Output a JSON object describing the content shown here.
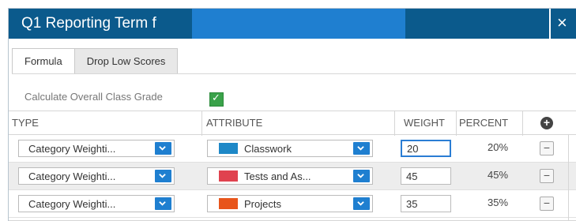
{
  "dialog": {
    "title": "Q1 Reporting Term f",
    "close_glyph": "×"
  },
  "tabs": [
    {
      "label": "Formula",
      "active": true
    },
    {
      "label": "Drop Low Scores",
      "active": false
    }
  ],
  "calc": {
    "label": "Calculate Overall Class Grade",
    "checked": true
  },
  "grid": {
    "headers": {
      "type": "TYPE",
      "attribute": "ATTRIBUTE",
      "weight": "WEIGHT",
      "percent": "PERCENT",
      "add_icon": "plus-circle-icon"
    },
    "rows": [
      {
        "type": "Category Weighti...",
        "attribute": "Classwork",
        "color": "#1e88c7",
        "weight": "20",
        "percent": "20%"
      },
      {
        "type": "Category Weighti...",
        "attribute": "Tests and As...",
        "color": "#e0424f",
        "weight": "45",
        "percent": "45%"
      },
      {
        "type": "Category Weighti...",
        "attribute": "Projects",
        "color": "#e8551b",
        "weight": "35",
        "percent": "35%"
      }
    ],
    "remove_glyph": "−"
  },
  "colors": {
    "titlebar": "#0b5a8c",
    "accent": "#1f7fd0",
    "check": "#3aa24a"
  }
}
